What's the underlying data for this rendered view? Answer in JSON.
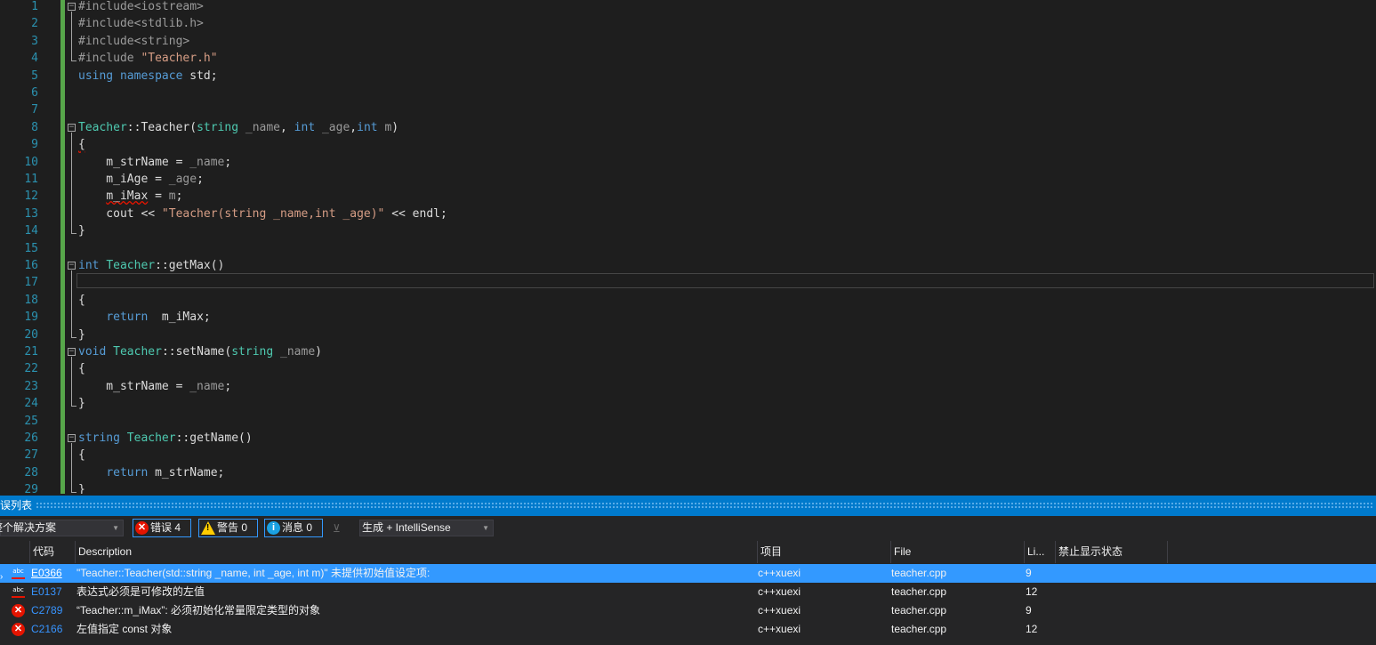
{
  "editor": {
    "line_numbers": [
      "1",
      "2",
      "3",
      "4",
      "5",
      "6",
      "7",
      "8",
      "9",
      "10",
      "11",
      "12",
      "13",
      "14",
      "15",
      "16",
      "17",
      "18",
      "19",
      "20",
      "21",
      "22",
      "23",
      "24",
      "25",
      "26",
      "27",
      "28",
      "29"
    ],
    "lines": [
      [
        {
          "t": "#include<iostream>",
          "c": "pp"
        }
      ],
      [
        {
          "t": "#include<stdlib.h>",
          "c": "pp"
        }
      ],
      [
        {
          "t": "#include<string>",
          "c": "pp"
        }
      ],
      [
        {
          "t": "#include ",
          "c": "pp"
        },
        {
          "t": "\"Teacher.h\"",
          "c": "st"
        }
      ],
      [
        {
          "t": "using",
          "c": "kw"
        },
        {
          "t": " "
        },
        {
          "t": "namespace",
          "c": "kw"
        },
        {
          "t": " std;"
        }
      ],
      [],
      [],
      [
        {
          "t": "Teacher",
          "c": "ty"
        },
        {
          "t": "::Teacher("
        },
        {
          "t": "string",
          "c": "ty"
        },
        {
          "t": " "
        },
        {
          "t": "_name",
          "c": "pm"
        },
        {
          "t": ", "
        },
        {
          "t": "int",
          "c": "kw"
        },
        {
          "t": " "
        },
        {
          "t": "_age",
          "c": "pm"
        },
        {
          "t": ","
        },
        {
          "t": "int",
          "c": "kw"
        },
        {
          "t": " "
        },
        {
          "t": "m",
          "c": "pm"
        },
        {
          "t": ")"
        }
      ],
      [
        {
          "t": "{",
          "w": true
        }
      ],
      [
        {
          "t": "    m_strName = "
        },
        {
          "t": "_name",
          "c": "pm"
        },
        {
          "t": ";"
        }
      ],
      [
        {
          "t": "    m_iAge = "
        },
        {
          "t": "_age",
          "c": "pm"
        },
        {
          "t": ";"
        }
      ],
      [
        {
          "t": "    "
        },
        {
          "t": "m_iMax",
          "w": true
        },
        {
          "t": " = "
        },
        {
          "t": "m",
          "c": "pm"
        },
        {
          "t": ";"
        }
      ],
      [
        {
          "t": "    cout << "
        },
        {
          "t": "\"Teacher(string _name,int _age)\"",
          "c": "st"
        },
        {
          "t": " << endl;"
        }
      ],
      [
        {
          "t": "}"
        }
      ],
      [],
      [
        {
          "t": "int",
          "c": "kw"
        },
        {
          "t": " "
        },
        {
          "t": "Teacher",
          "c": "ty"
        },
        {
          "t": "::getMax()"
        }
      ],
      [],
      [
        {
          "t": "{"
        }
      ],
      [
        {
          "t": "    "
        },
        {
          "t": "return",
          "c": "kw"
        },
        {
          "t": "  m_iMax;"
        }
      ],
      [
        {
          "t": "}"
        }
      ],
      [
        {
          "t": "void",
          "c": "kw"
        },
        {
          "t": " "
        },
        {
          "t": "Teacher",
          "c": "ty"
        },
        {
          "t": "::setName("
        },
        {
          "t": "string",
          "c": "ty"
        },
        {
          "t": " "
        },
        {
          "t": "_name",
          "c": "pm"
        },
        {
          "t": ")"
        }
      ],
      [
        {
          "t": "{"
        }
      ],
      [
        {
          "t": "    m_strName = "
        },
        {
          "t": "_name",
          "c": "pm"
        },
        {
          "t": ";"
        }
      ],
      [
        {
          "t": "}"
        }
      ],
      [],
      [
        {
          "t": "string",
          "c": "kw"
        },
        {
          "t": " "
        },
        {
          "t": "Teacher",
          "c": "ty"
        },
        {
          "t": "::getName()"
        }
      ],
      [
        {
          "t": "{"
        }
      ],
      [
        {
          "t": "    "
        },
        {
          "t": "return",
          "c": "kw"
        },
        {
          "t": " m_strName;"
        }
      ],
      [
        {
          "t": "}"
        }
      ]
    ]
  },
  "error_list": {
    "title": "误列表",
    "scope_combo": "整个解决方案",
    "errors_button": "错误 4",
    "warnings_button": "警告 0",
    "messages_button": "消息 0",
    "build_combo": "生成 + IntelliSense",
    "columns": {
      "code": "代码",
      "description": "Description",
      "project": "项目",
      "file": "File",
      "line": "Li...",
      "suppression": "禁止显示状态"
    },
    "rows": [
      {
        "icon": "abc",
        "code": "E0366",
        "description": "\"Teacher::Teacher(std::string _name, int _age, int m)\" 未提供初始值设定项:",
        "project": "c++xuexi",
        "file": "teacher.cpp",
        "line": "9",
        "selected": true
      },
      {
        "icon": "abc",
        "code": "E0137",
        "description": "表达式必须是可修改的左值",
        "project": "c++xuexi",
        "file": "teacher.cpp",
        "line": "12",
        "selected": false
      },
      {
        "icon": "x",
        "code": "C2789",
        "description": "“Teacher::m_iMax”: 必须初始化常量限定类型的对象",
        "project": "c++xuexi",
        "file": "teacher.cpp",
        "line": "9",
        "selected": false
      },
      {
        "icon": "x",
        "code": "C2166",
        "description": "左值指定 const 对象",
        "project": "c++xuexi",
        "file": "teacher.cpp",
        "line": "12",
        "selected": false
      }
    ]
  }
}
